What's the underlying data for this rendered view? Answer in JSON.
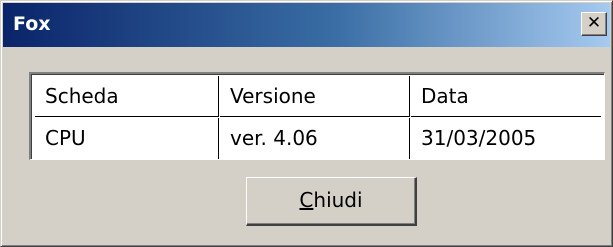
{
  "window": {
    "title": "Fox",
    "close_glyph": "✕"
  },
  "table": {
    "columns": [
      "Scheda",
      "Versione",
      "Data"
    ],
    "rows": [
      [
        "CPU",
        "ver. 4.06",
        "31/03/2005"
      ]
    ]
  },
  "buttons": {
    "close": {
      "mnemonic": "C",
      "rest": "hiudi"
    }
  }
}
